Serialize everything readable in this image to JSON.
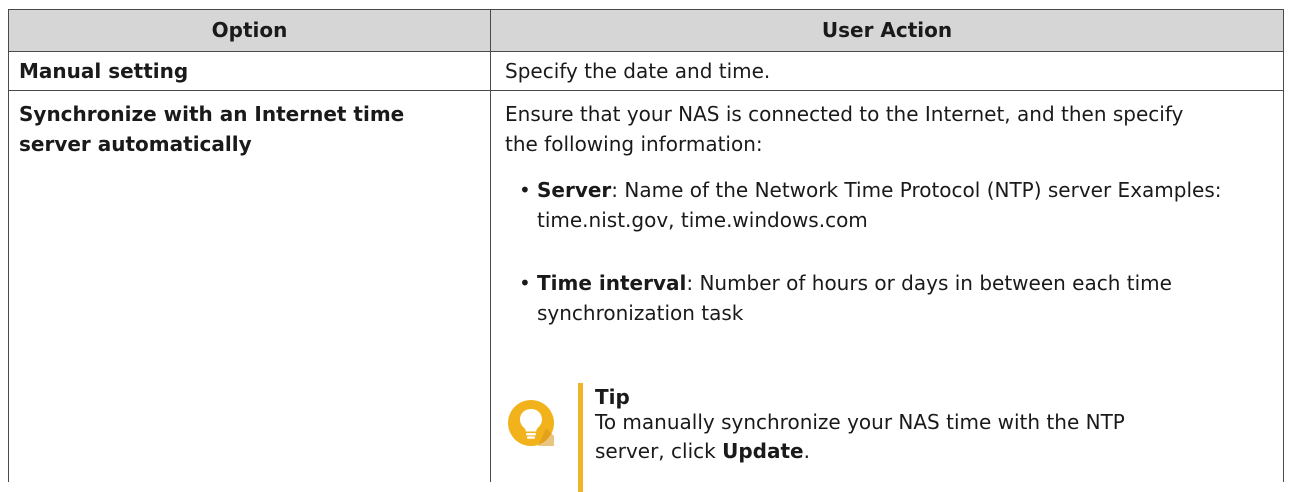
{
  "table": {
    "headers": {
      "option": "Option",
      "action": "User Action"
    },
    "rows": [
      {
        "option": "Manual setting",
        "action": "Specify the date and time."
      },
      {
        "option": "Synchronize with an Internet time server automatically",
        "action_intro": "Ensure that your NAS is connected to the Internet, and then specify the following information:",
        "bullets": [
          {
            "term": "Server",
            "text": ": Name of the Network Time Protocol (NTP) server Examples: time.nist.gov, time.windows.com"
          },
          {
            "term": "Time interval",
            "text": ": Number of hours or days in between each time synchronization task"
          }
        ],
        "tip": {
          "title": "Tip",
          "text_before": "To manually synchronize your NAS time with the NTP server, click ",
          "button_name": "Update",
          "text_after": "."
        }
      }
    ]
  },
  "colors": {
    "header_bg": "#d6d6d6",
    "border": "#4a4a4a",
    "tip_accent": "#f0b429",
    "tip_icon_bg": "#f2b21b"
  },
  "icons": {
    "tip": "lightbulb-icon",
    "bullet": "bullet-dot"
  }
}
